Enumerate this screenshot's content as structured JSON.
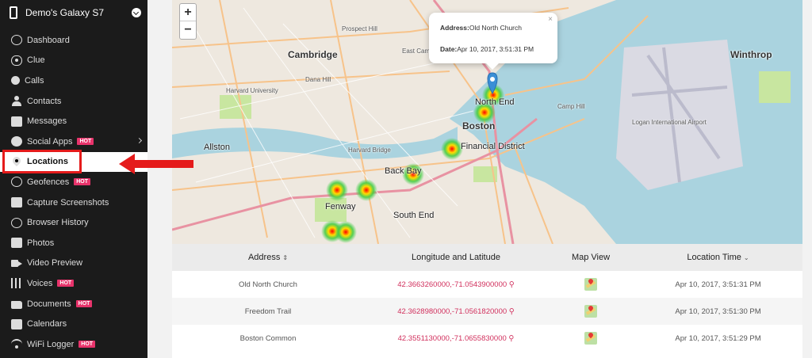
{
  "device": {
    "name": "Demo's Galaxy S7"
  },
  "sidebar": {
    "items": [
      {
        "label": "Dashboard",
        "icon": "dashboard-icon",
        "hot": ""
      },
      {
        "label": "Clue",
        "icon": "eye-icon",
        "hot": ""
      },
      {
        "label": "Calls",
        "icon": "phone-icon",
        "hot": ""
      },
      {
        "label": "Contacts",
        "icon": "user-icon",
        "hot": ""
      },
      {
        "label": "Messages",
        "icon": "message-icon",
        "hot": ""
      },
      {
        "label": "Social Apps",
        "icon": "chat-icon",
        "hot": "HOT"
      },
      {
        "label": "Locations",
        "icon": "location-pin-icon",
        "hot": ""
      },
      {
        "label": "Geofences",
        "icon": "geofence-icon",
        "hot": "HOT"
      },
      {
        "label": "Capture Screenshots",
        "icon": "screenshot-icon",
        "hot": ""
      },
      {
        "label": "Browser History",
        "icon": "history-icon",
        "hot": ""
      },
      {
        "label": "Photos",
        "icon": "photo-icon",
        "hot": ""
      },
      {
        "label": "Video Preview",
        "icon": "video-icon",
        "hot": ""
      },
      {
        "label": "Voices",
        "icon": "voice-bars-icon",
        "hot": "HOT"
      },
      {
        "label": "Documents",
        "icon": "folder-icon",
        "hot": "HOT"
      },
      {
        "label": "Calendars",
        "icon": "calendar-icon",
        "hot": ""
      },
      {
        "label": "WiFi Logger",
        "icon": "wifi-icon",
        "hot": "HOT"
      }
    ],
    "active": "Locations"
  },
  "map": {
    "zoom_in": "+",
    "zoom_out": "−",
    "popup": {
      "address_label": "Address:",
      "address_value": "Old North Church",
      "date_label": "Date:",
      "date_value": "Apr 10, 2017, 3:51:31 PM",
      "close": "×"
    },
    "labels": [
      "Cambridge",
      "Harvard University",
      "Allston",
      "Harvard Bridge",
      "Fenway",
      "Back Bay",
      "South End",
      "Boston",
      "Financial District",
      "North End",
      "Winthrop",
      "Logan International Airport",
      "Camp Hill",
      "Dana Hill",
      "Prospect Hill",
      "East Cambridge"
    ]
  },
  "table": {
    "headers": {
      "address": "Address",
      "coords": "Longitude and Latitude",
      "map_view": "Map View",
      "time": "Location Time"
    },
    "rows": [
      {
        "address": "Old North Church",
        "coords": "42.3663260000,-71.0543900000",
        "time": "Apr 10, 2017, 3:51:31 PM"
      },
      {
        "address": "Freedom Trail",
        "coords": "42.3628980000,-71.0561820000",
        "time": "Apr 10, 2017, 3:51:30 PM"
      },
      {
        "address": "Boston Common",
        "coords": "42.3551130000,-71.0655830000",
        "time": "Apr 10, 2017, 3:51:29 PM"
      }
    ]
  },
  "colors": {
    "sidebar_bg": "#1b1b1b",
    "hot_badge": "#e8336b",
    "coord_text": "#d1305d",
    "highlight": "#e51b1b",
    "popup_pin": "#3a8fd6"
  }
}
